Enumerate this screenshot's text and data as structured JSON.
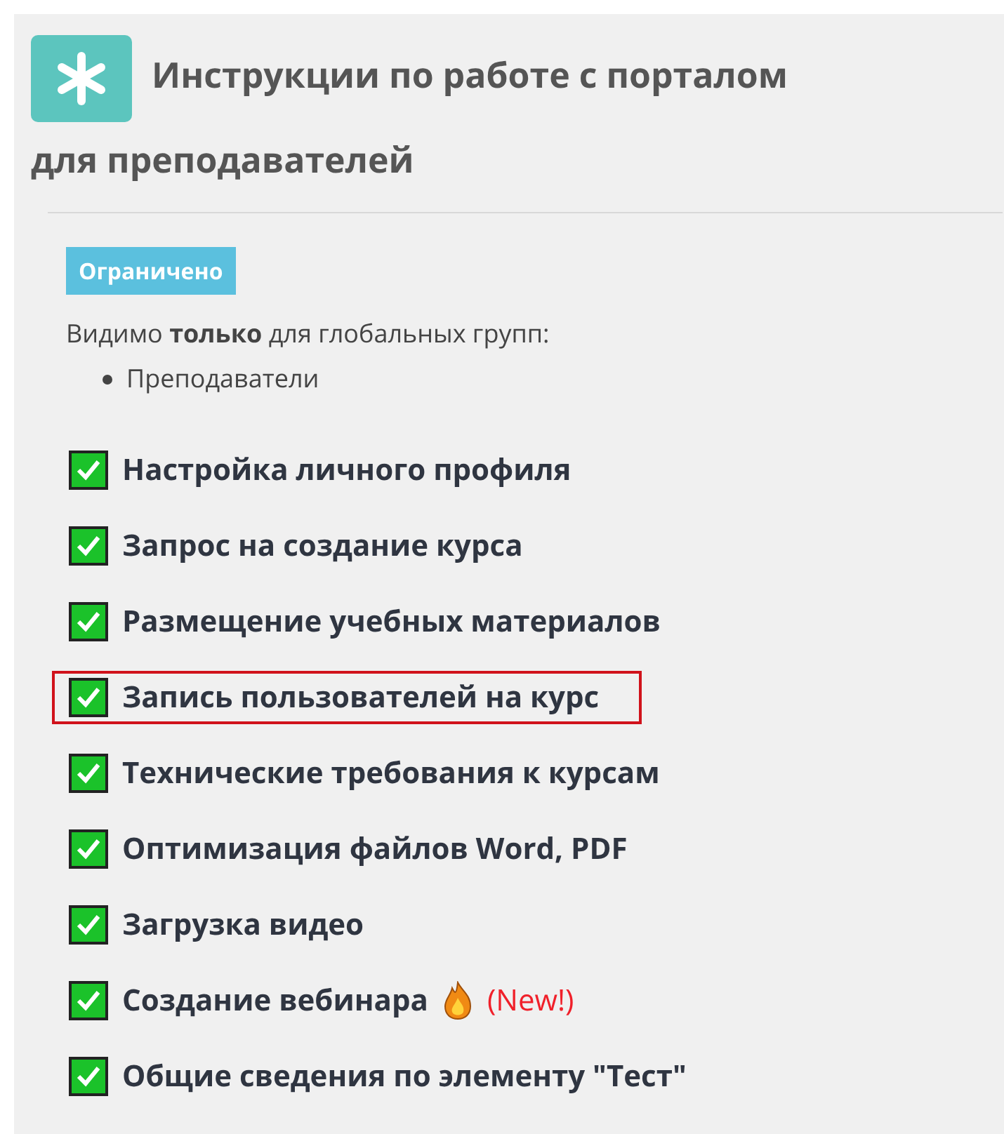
{
  "title_lines": [
    "Инструкции по работе с порталом",
    "для преподавателей"
  ],
  "restriction": {
    "badge": "Ограничено",
    "text": "Видимо **только** для глобальных групп:",
    "groups": [
      "Преподаватели"
    ]
  },
  "items": [
    {
      "label": "Настройка личного профиля",
      "checked": true,
      "highlighted": false
    },
    {
      "label": "Запрос на создание курса",
      "checked": true,
      "highlighted": false
    },
    {
      "label": "Размещение учебных материалов",
      "checked": true,
      "highlighted": false
    },
    {
      "label": "Запись пользователей на курс",
      "checked": true,
      "highlighted": true
    },
    {
      "label": "Технические требования к курсам",
      "checked": true,
      "highlighted": false
    },
    {
      "label": "Оптимизация файлов Word, PDF",
      "checked": true,
      "highlighted": false
    },
    {
      "label": "Загрузка видео",
      "checked": true,
      "highlighted": false
    },
    {
      "label": "Создание вебинара",
      "checked": true,
      "highlighted": false,
      "note": "(New!)"
    },
    {
      "label": "Общие сведения по элементу \"Тест\"",
      "checked": true,
      "highlighted": false
    }
  ]
}
